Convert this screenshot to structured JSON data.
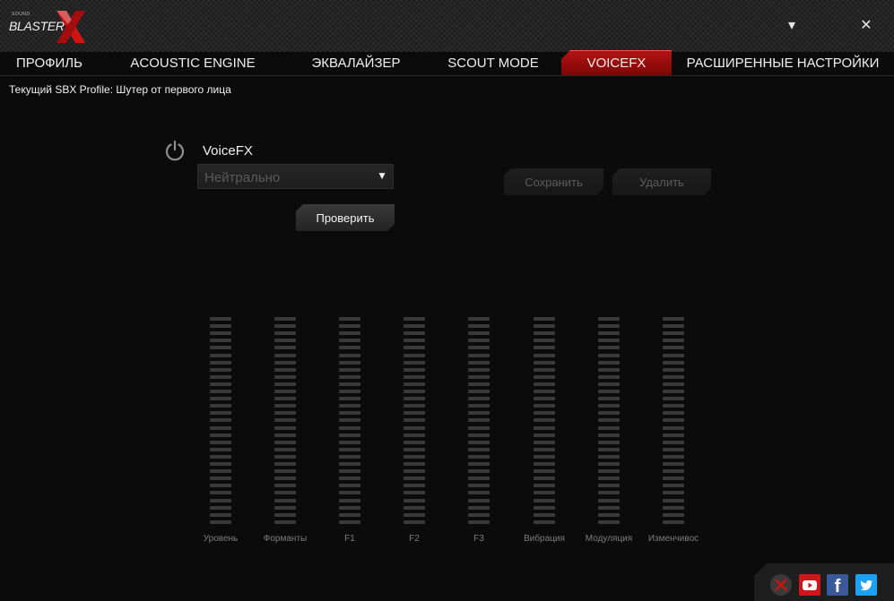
{
  "window": {
    "logo_small": "SOUND",
    "logo_text": "BLASTER",
    "minimize_glyph": "▾",
    "close_glyph": "✕"
  },
  "tabs": [
    {
      "label": "ПРОФИЛЬ",
      "active": false
    },
    {
      "label": "ACOUSTIC ENGINE",
      "active": false
    },
    {
      "label": "ЭКВАЛАЙЗЕР",
      "active": false
    },
    {
      "label": "SCOUT MODE",
      "active": false
    },
    {
      "label": "VOICEFX",
      "active": true
    },
    {
      "label": "РАСШИРЕННЫЕ НАСТРОЙКИ",
      "active": false
    }
  ],
  "profile": {
    "text": "Текущий SBX Profile: Шутер от первого лица"
  },
  "voicefx": {
    "title": "VoiceFX",
    "preset_value": "Нейтрально",
    "test_button": "Проверить",
    "save_button": "Сохранить",
    "delete_button": "Удалить"
  },
  "sliders": [
    {
      "label": "Уровень"
    },
    {
      "label": "Форманты"
    },
    {
      "label": "F1"
    },
    {
      "label": "F2"
    },
    {
      "label": "F3"
    },
    {
      "label": "Вибрация"
    },
    {
      "label": "Модуляция"
    },
    {
      "label": "Изменчивос"
    }
  ],
  "social": {
    "icons": [
      "disabled-icon",
      "youtube-icon",
      "facebook-icon",
      "twitter-icon"
    ]
  },
  "colors": {
    "accent": "#b51515",
    "background": "#0b0b0b",
    "titlebar": "#1c1c1c"
  }
}
